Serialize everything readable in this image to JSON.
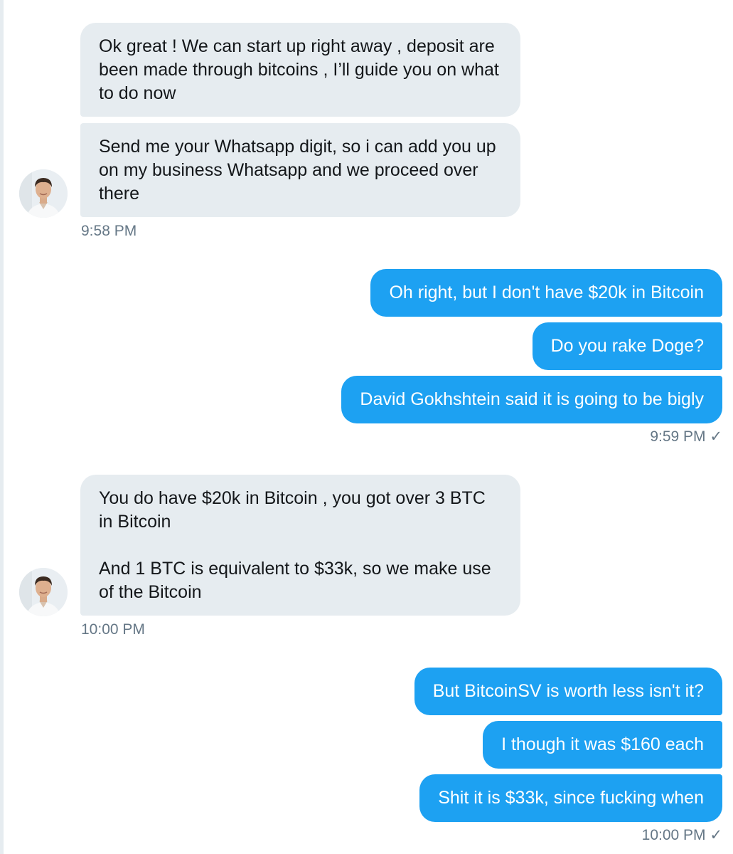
{
  "conversation": {
    "group1": {
      "messages": [
        "Ok great ! We can start up right away , deposit are been made through bitcoins , I’ll guide you on what to do now",
        "Send me your Whatsapp digit, so i can add you up on my business Whatsapp and we proceed over there"
      ],
      "time": "9:58 PM"
    },
    "group2": {
      "messages": [
        "Oh right, but I don't have $20k in Bitcoin",
        "Do you rake Doge?",
        "David Gokhshtein said it is going to be bigly"
      ],
      "time": "9:59 PM",
      "status_icon": "✓"
    },
    "group3": {
      "messages": [
        "You do have $20k in Bitcoin , you got over 3 BTC in Bitcoin\n\nAnd 1 BTC is equivalent to $33k, so we make use of the Bitcoin"
      ],
      "time": "10:00 PM"
    },
    "group4": {
      "messages": [
        "But BitcoinSV is worth less isn't it?",
        "I though it was $160 each",
        "Shit it is $33k, since fucking when"
      ],
      "time": "10:00 PM",
      "status_icon": "✓"
    }
  },
  "colors": {
    "incoming_bubble": "#e6ecf0",
    "outgoing_bubble": "#1da1f2",
    "timestamp": "#657786"
  },
  "icons": {
    "avatar": "contact-avatar",
    "read_receipt": "checkmark-icon"
  }
}
